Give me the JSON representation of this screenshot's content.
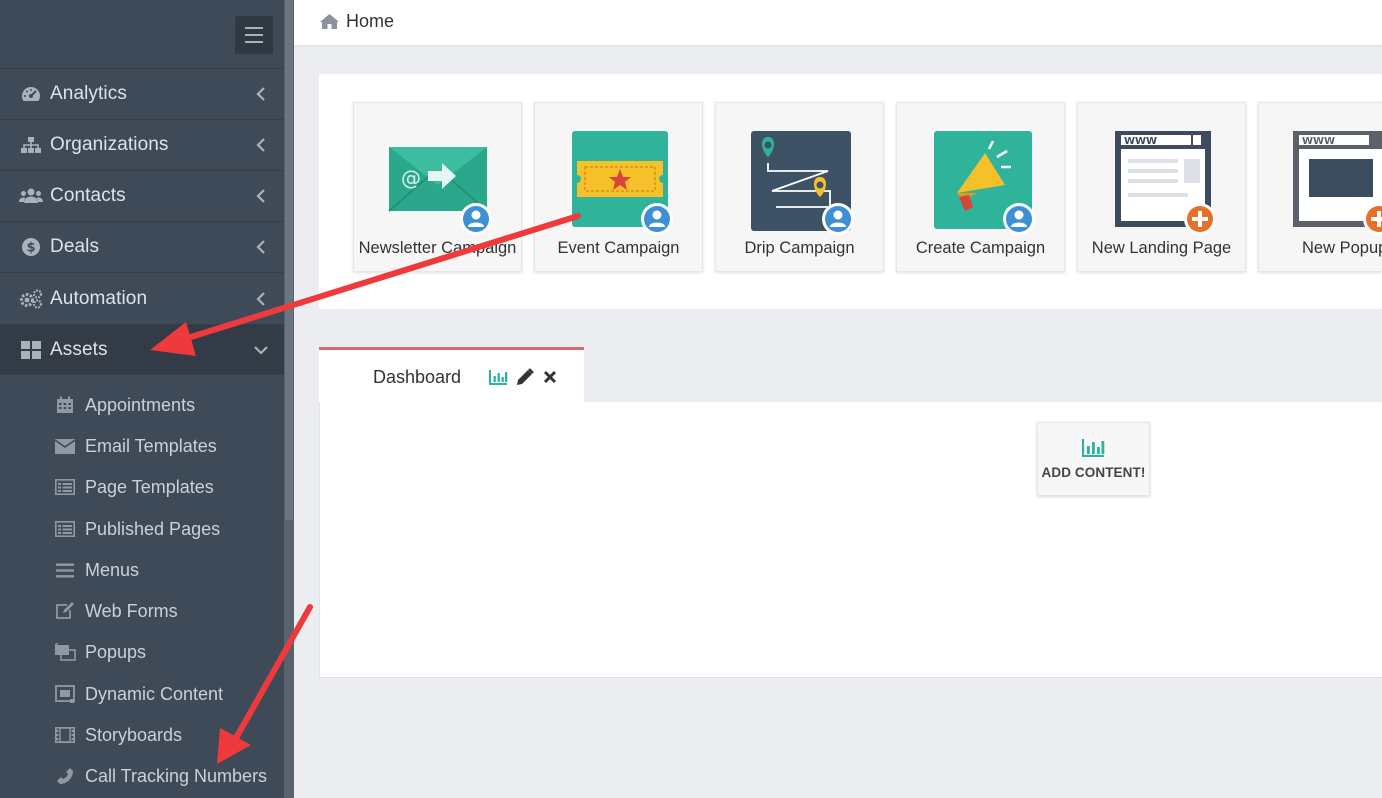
{
  "sidebar": {
    "menu_toggle_icon": "hamburger-icon",
    "items": [
      {
        "label": "Analytics",
        "icon": "tachometer-icon"
      },
      {
        "label": "Organizations",
        "icon": "sitemap-icon"
      },
      {
        "label": "Contacts",
        "icon": "users-icon"
      },
      {
        "label": "Deals",
        "icon": "dollar-icon"
      },
      {
        "label": "Automation",
        "icon": "cogs-icon"
      },
      {
        "label": "Assets",
        "icon": "grid-icon",
        "expanded": true
      }
    ],
    "sub_items": [
      {
        "label": "Appointments",
        "icon": "calendar-icon"
      },
      {
        "label": "Email Templates",
        "icon": "envelope-icon"
      },
      {
        "label": "Page Templates",
        "icon": "list-alt-icon"
      },
      {
        "label": "Published Pages",
        "icon": "list-alt-icon"
      },
      {
        "label": "Menus",
        "icon": "bars-icon"
      },
      {
        "label": "Web Forms",
        "icon": "edit-icon"
      },
      {
        "label": "Popups",
        "icon": "popup-icon"
      },
      {
        "label": "Dynamic Content",
        "icon": "dynamic-content-icon"
      },
      {
        "label": "Storyboards",
        "icon": "film-icon"
      },
      {
        "label": "Call Tracking Numbers",
        "icon": "phone-icon"
      }
    ]
  },
  "breadcrumb": {
    "home_label": "Home",
    "icon": "home-icon"
  },
  "shortcuts": [
    {
      "label": "Newsletter Campaign",
      "icon": "newsletter-envelope-icon"
    },
    {
      "label": "Event Campaign",
      "icon": "event-ticket-icon"
    },
    {
      "label": "Drip Campaign",
      "icon": "drip-route-icon"
    },
    {
      "label": "Create Campaign",
      "icon": "megaphone-icon"
    },
    {
      "label": "New Landing Page",
      "icon": "landing-page-icon"
    },
    {
      "label": "New Popup",
      "icon": "popup-window-icon"
    }
  ],
  "dashboard": {
    "tab_label": "Dashboard",
    "tab_icons": [
      "bar-chart-icon",
      "pencil-icon",
      "close-icon"
    ],
    "add_content_label": "ADD CONTENT!"
  },
  "colors": {
    "sidebar_bg": "#3f4a58",
    "accent_teal": "#2ab3a0",
    "tab_accent": "#e0676f",
    "annotation_arrow": "#ee3a3d"
  }
}
